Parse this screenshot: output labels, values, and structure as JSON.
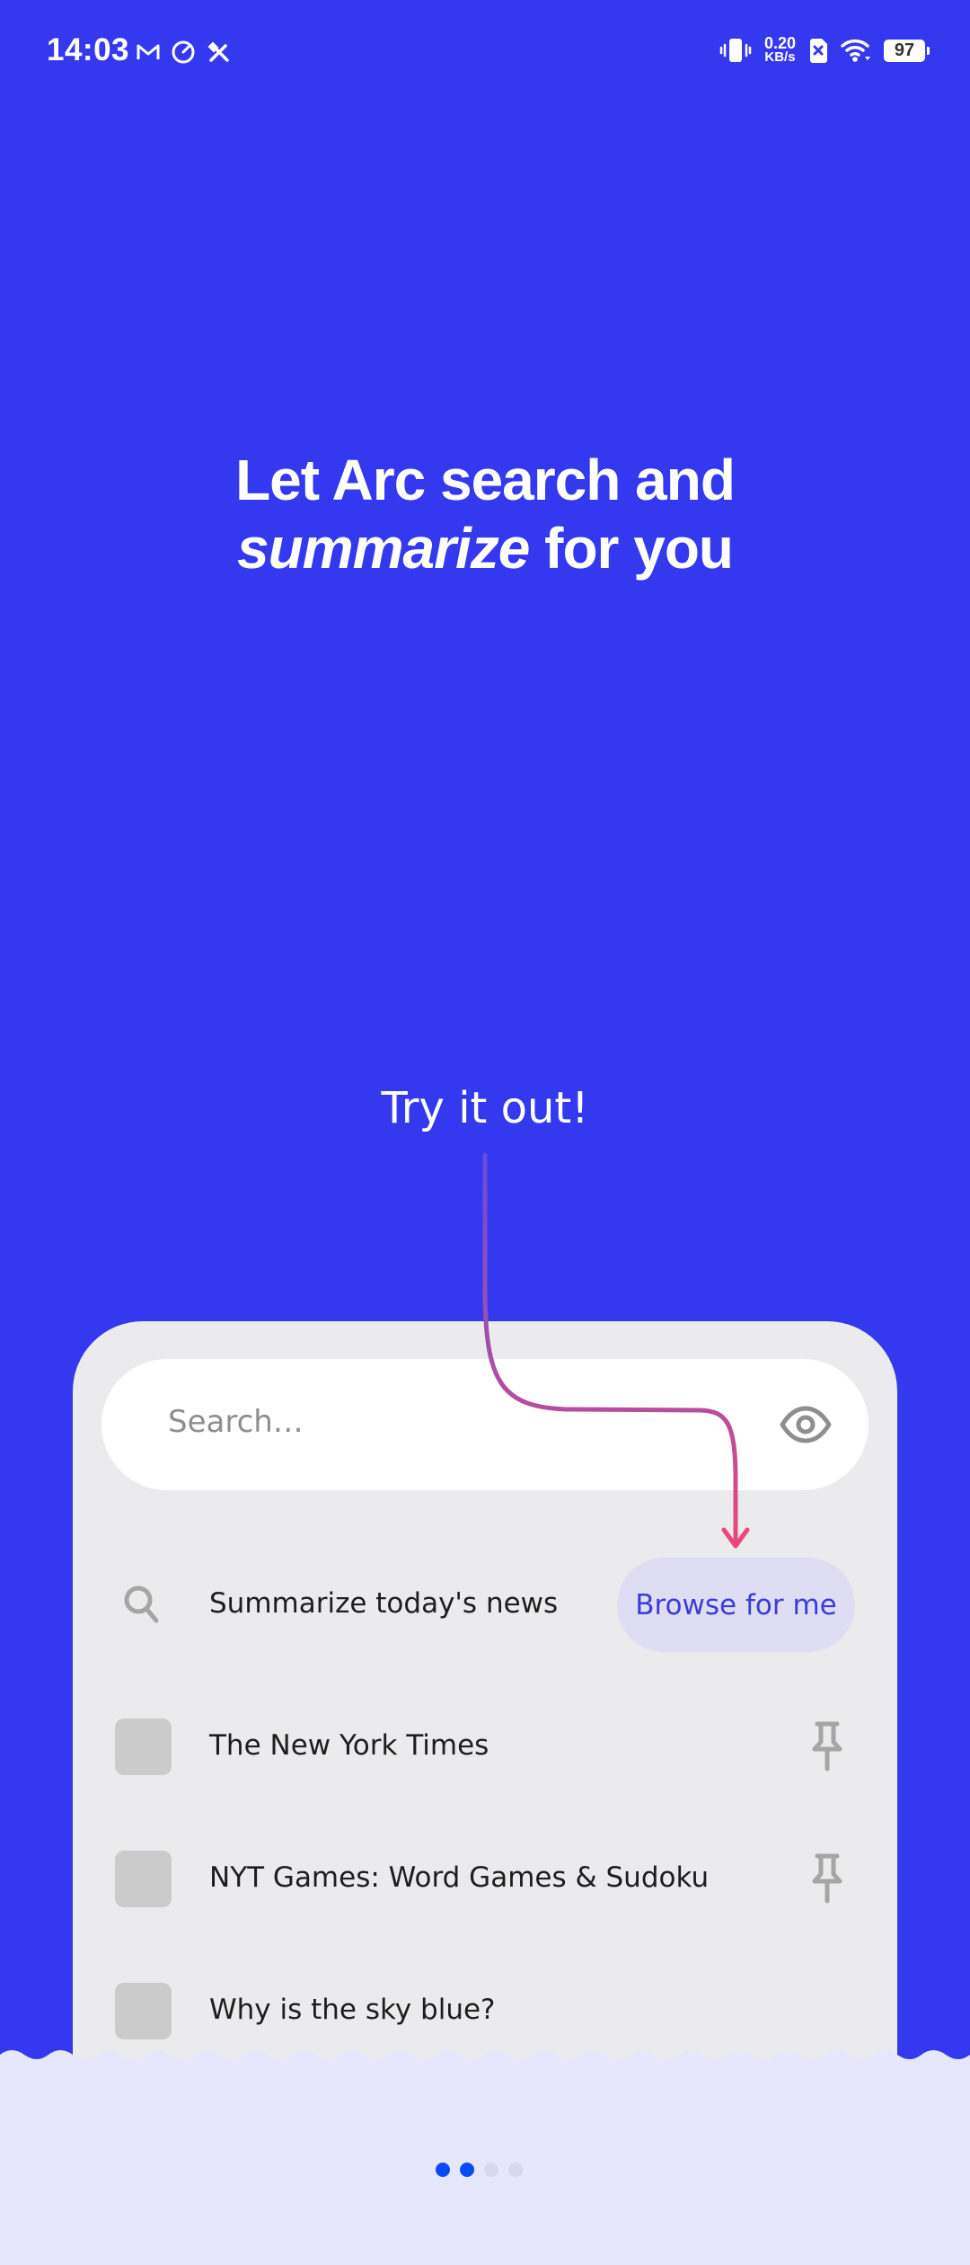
{
  "status_bar": {
    "time": "14:03",
    "left_icons": [
      "gmail-icon",
      "speed-gauge-icon",
      "tools-icon"
    ],
    "net_speed_value": "0.20",
    "net_speed_unit": "KB/s",
    "right_icons": [
      "vibrate-icon",
      "no-sim-icon",
      "wifi-icon"
    ],
    "battery": "97"
  },
  "headline": {
    "line1": "Let Arc search and",
    "line2_italic": "summarize",
    "line2_rest": " for you"
  },
  "try_label": "Try it out!",
  "demo_card": {
    "search_placeholder": "Search…",
    "eye_icon": "eye-icon",
    "suggestion": {
      "label": "Summarize today's news",
      "button_label": "Browse for me"
    },
    "items": [
      {
        "label": "The New York Times",
        "pinned": true
      },
      {
        "label": "NYT Games: Word Games & Sudoku",
        "pinned": true
      },
      {
        "label": "Why is the sky blue?",
        "pinned": false
      }
    ]
  },
  "pager": {
    "total": 4,
    "active": [
      0,
      1
    ],
    "active_color": "#0B4BF5",
    "inactive_color": "#D7D8EC"
  },
  "colors": {
    "background": "#3439F0",
    "card": "#EBEBED",
    "bottom_panel": "#E6E7FC",
    "button_bg": "#DEDDF3",
    "button_text": "#3A3ED8",
    "arrow_start": "#7A4FD0",
    "arrow_end": "#E8497A"
  }
}
